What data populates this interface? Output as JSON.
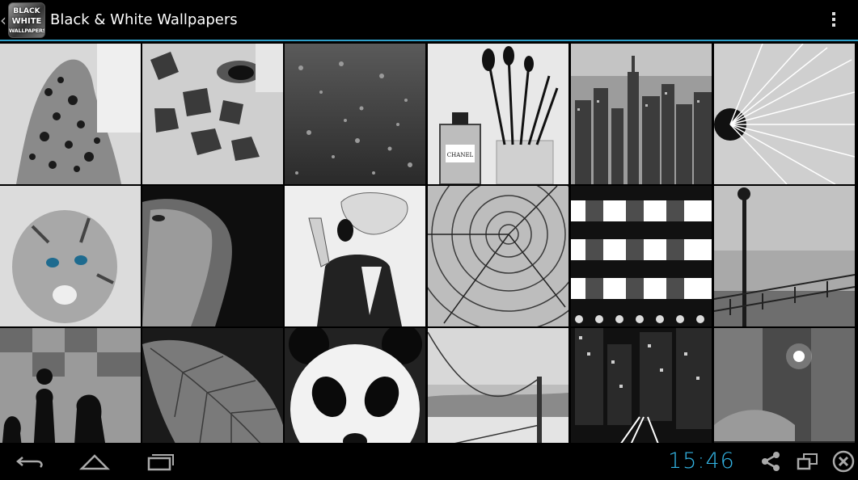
{
  "app": {
    "title": "Black & White Wallpapers",
    "icon_text_line1": "BLACK",
    "icon_text_line2": "WHITE",
    "icon_text_line3": "WALLPAPERS"
  },
  "icons": {
    "back": "chevron-left-icon",
    "overflow": "overflow-menu-icon",
    "nav_back": "back-arrow-icon",
    "nav_home": "home-icon",
    "nav_recents": "recent-apps-icon",
    "share": "share-icon",
    "screen": "screen-icon",
    "close": "close-icon"
  },
  "colors": {
    "accent": "#33b5e5",
    "divider": "#2f9fc9",
    "background": "#000000"
  },
  "wallpapers": [
    {
      "subject": "leopard"
    },
    {
      "subject": "giraffe"
    },
    {
      "subject": "rain drops"
    },
    {
      "subject": "perfume and brushes"
    },
    {
      "subject": "city skyline"
    },
    {
      "subject": "dandelion"
    },
    {
      "subject": "kitten"
    },
    {
      "subject": "lion"
    },
    {
      "subject": "woman illustration"
    },
    {
      "subject": "tree rings"
    },
    {
      "subject": "checkered pattern"
    },
    {
      "subject": "lamp post promenade"
    },
    {
      "subject": "chess pieces"
    },
    {
      "subject": "leaf"
    },
    {
      "subject": "panda"
    },
    {
      "subject": "bridge"
    },
    {
      "subject": "city at night"
    },
    {
      "subject": "canal street"
    }
  ],
  "perfume_label": "CHANEL",
  "status": {
    "clock": "15:46"
  }
}
